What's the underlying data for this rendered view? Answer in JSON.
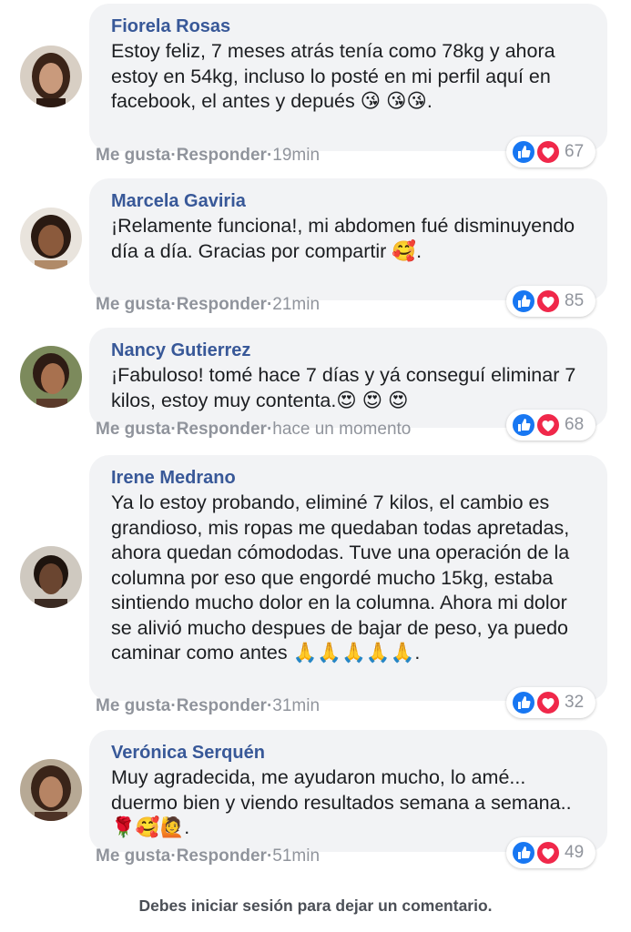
{
  "comments": [
    {
      "author": "Fiorela Rosas",
      "text": "Estoy feliz, 7 meses atrás tenía como 78kg y ahora estoy en 54kg, incluso lo posté en mi perfil aquí en facebook, el antes y depués 😘 😘😘.",
      "like_label": "Me gusta",
      "reply_label": "Responder",
      "separator": "·",
      "time": "19min",
      "reaction_count": "67",
      "avatar_color": "#7a5a48"
    },
    {
      "author": "Marcela Gaviria",
      "text": "¡Relamente funciona!, mi abdomen fué disminuyendo día a día. Gracias por compartir 🥰.",
      "like_label": "Me gusta",
      "reply_label": "Responder",
      "separator": "·",
      "time": "21min",
      "reaction_count": "85",
      "avatar_color": "#6b4a34"
    },
    {
      "author": "Nancy Gutierrez",
      "text": "¡Fabuloso! tomé hace 7 días y yá conseguí eliminar 7 kilos, estoy muy contenta.😍 😍 😍",
      "like_label": "Me gusta",
      "reply_label": "Responder",
      "separator": "·",
      "time": "hace un momento",
      "reaction_count": "68",
      "avatar_color": "#8a6248"
    },
    {
      "author": "Irene Medrano",
      "text": "Ya lo estoy probando, eliminé 7 kilos, el cambio es grandioso, mis ropas me quedaban todas apretadas, ahora quedan cómododas. Tuve una operación de la columna por eso que engordé mucho 15kg, estaba sintiendo mucho dolor en la columna. Ahora mi dolor se alivió mucho despues de bajar de peso, ya puedo caminar como antes 🙏🙏🙏🙏🙏.",
      "like_label": "Me gusta",
      "reply_label": "Responder",
      "separator": "·",
      "time": "31min",
      "reaction_count": "32",
      "avatar_color": "#4a3426"
    },
    {
      "author": "Verónica Serquén",
      "text": "Muy agradecida, me ayudaron mucho, lo amé... duermo bien y viendo resultados semana a semana..🌹🥰🙋.",
      "like_label": "Me gusta",
      "reply_label": "Responder",
      "separator": "·",
      "time": "51min",
      "reaction_count": "49",
      "avatar_color": "#6e4e3a"
    }
  ],
  "footer": "Debes iniciar sesión para dejar un comentario.",
  "colors": {
    "author": "#385898",
    "bubble": "#f2f3f5",
    "like": "#1877f2",
    "love": "#f0284a",
    "meta": "#90949c"
  },
  "icons": {
    "like": "thumbs-up-icon",
    "love": "heart-icon"
  }
}
